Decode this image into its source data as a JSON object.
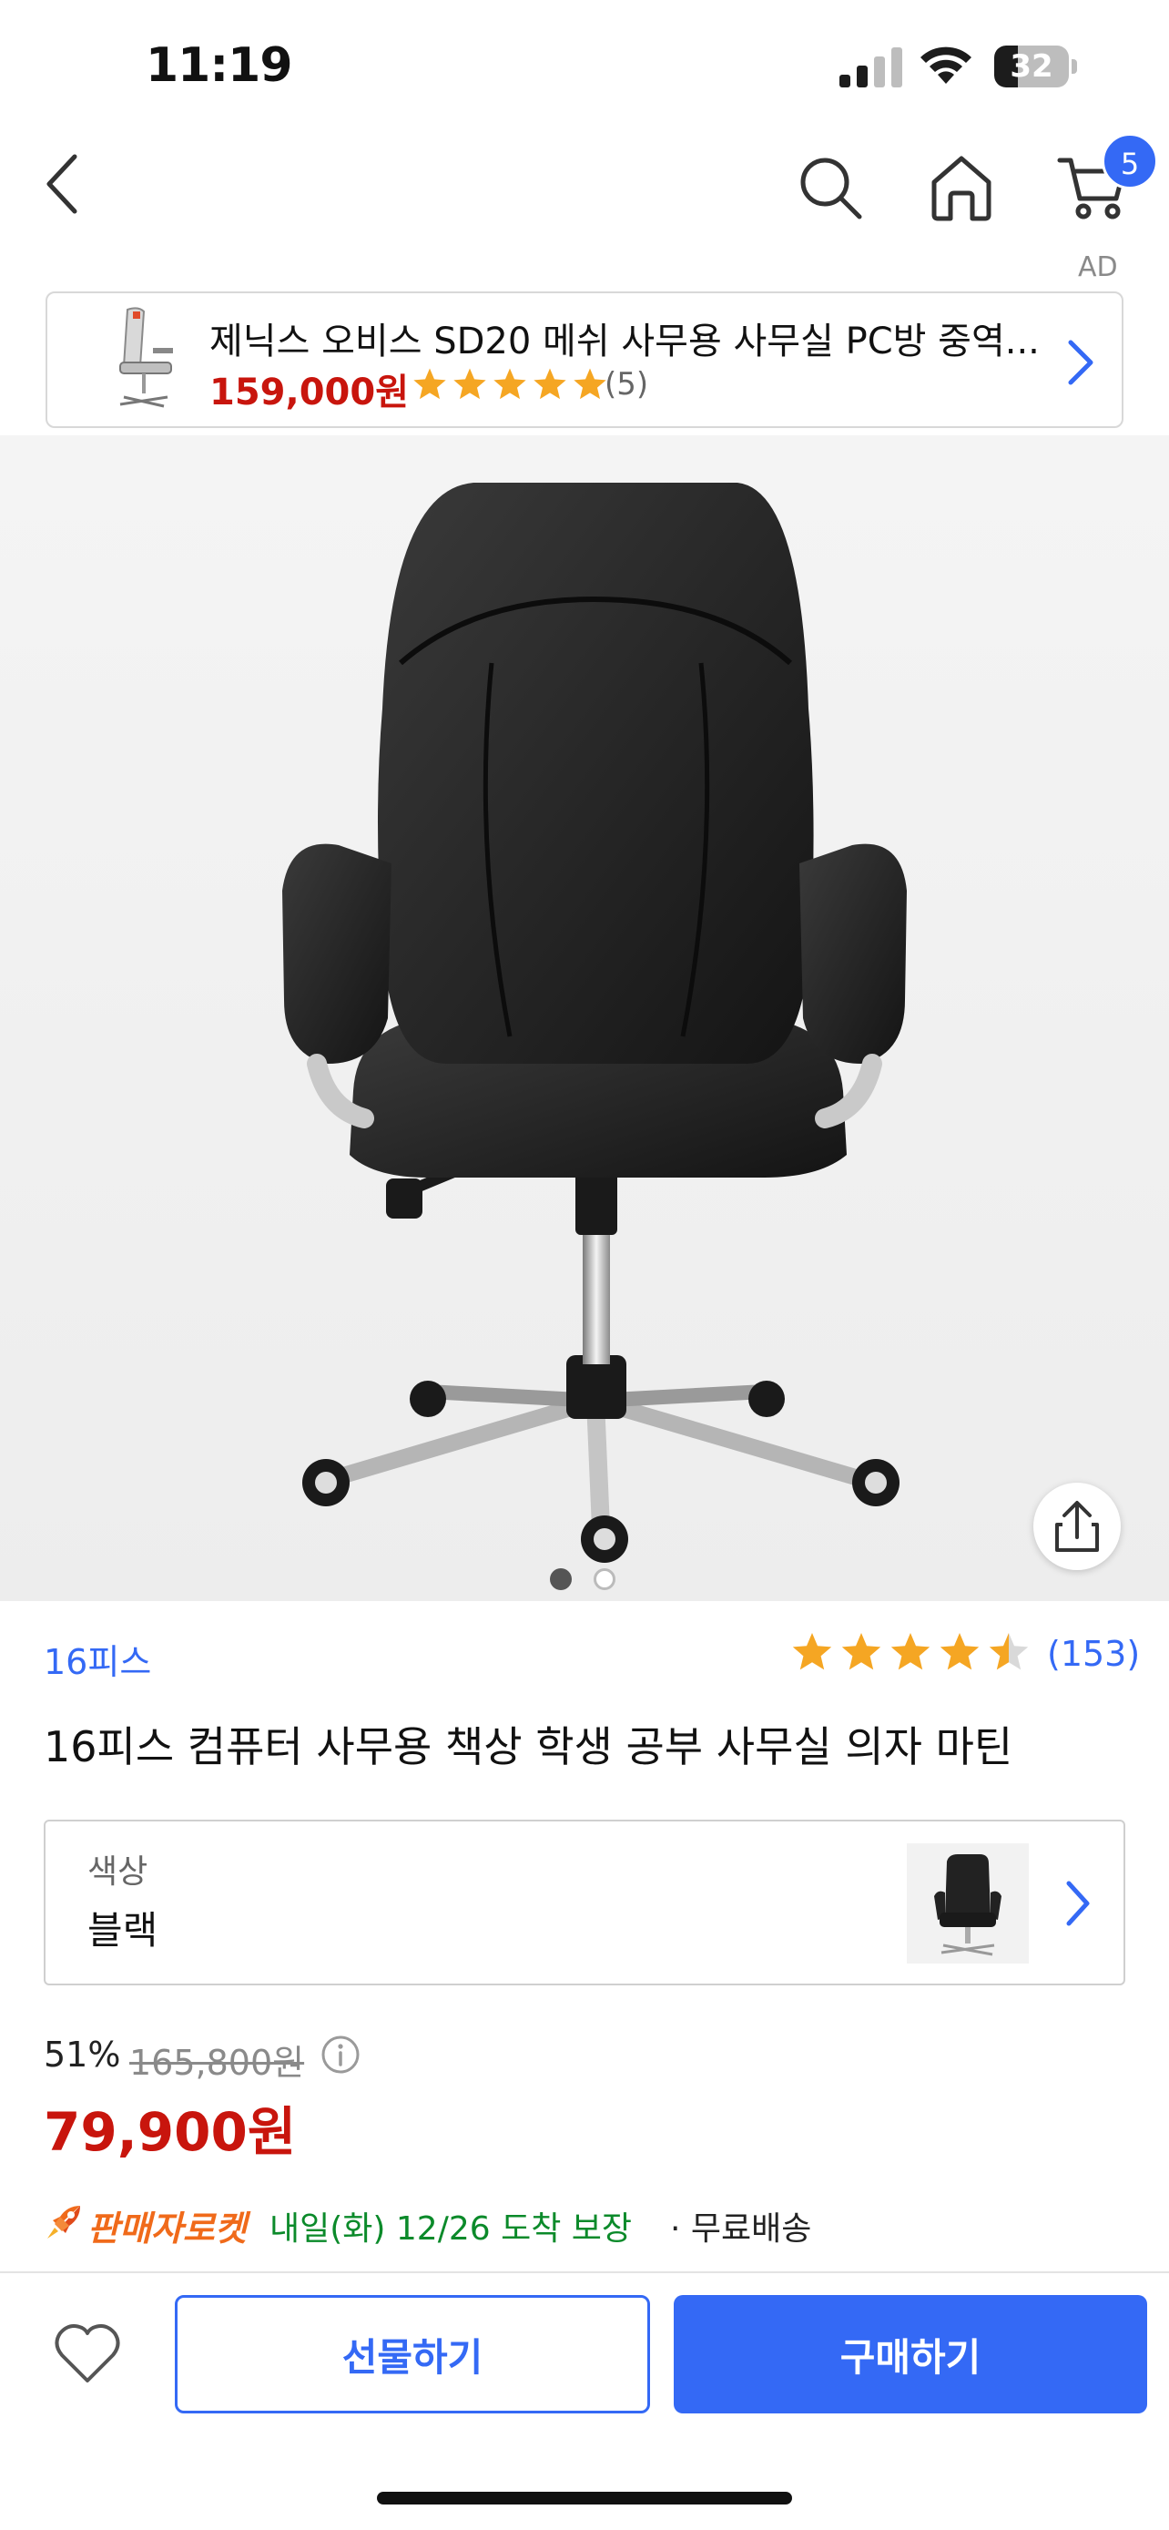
{
  "status_bar": {
    "time": "11:19",
    "battery": "32",
    "battery_level": 0.32
  },
  "nav": {
    "cart_count": "5",
    "ad_label": "AD"
  },
  "ad": {
    "title": "제닉스 오비스 SD20 메쉬 사무용 사무실 PC방 중역...",
    "price": "159,000원",
    "rating": 5,
    "review_count": "(5)"
  },
  "gallery": {
    "total_images": 2,
    "current_index": 1
  },
  "product": {
    "brand": "16피스",
    "rating": 4.5,
    "review_count": "(153)",
    "title": "16피스 컴퓨터 사무용 책상 학생 공부 사무실 의자 마틴",
    "option": {
      "label": "색상",
      "value": "블랙"
    },
    "discount_rate": "51%",
    "original_price": "165,800원",
    "sale_price": "79,900원"
  },
  "delivery": {
    "badge": "판매자로켓",
    "arrival": "내일(화) 12/26 도착 보장",
    "fee": "· 무료배송"
  },
  "actions": {
    "gift": "선물하기",
    "buy": "구매하기"
  },
  "colors": {
    "accent": "#3469f5",
    "price_red": "#c8150d",
    "star": "#f5a623",
    "rocket_orange": "#f06a1a",
    "delivery_green": "#0b8a2a"
  },
  "icons": [
    "back-icon",
    "search-icon",
    "home-icon",
    "cart-icon",
    "share-icon",
    "info-icon",
    "rocket-icon",
    "heart-icon",
    "chevron-right-icon",
    "star-icon"
  ]
}
